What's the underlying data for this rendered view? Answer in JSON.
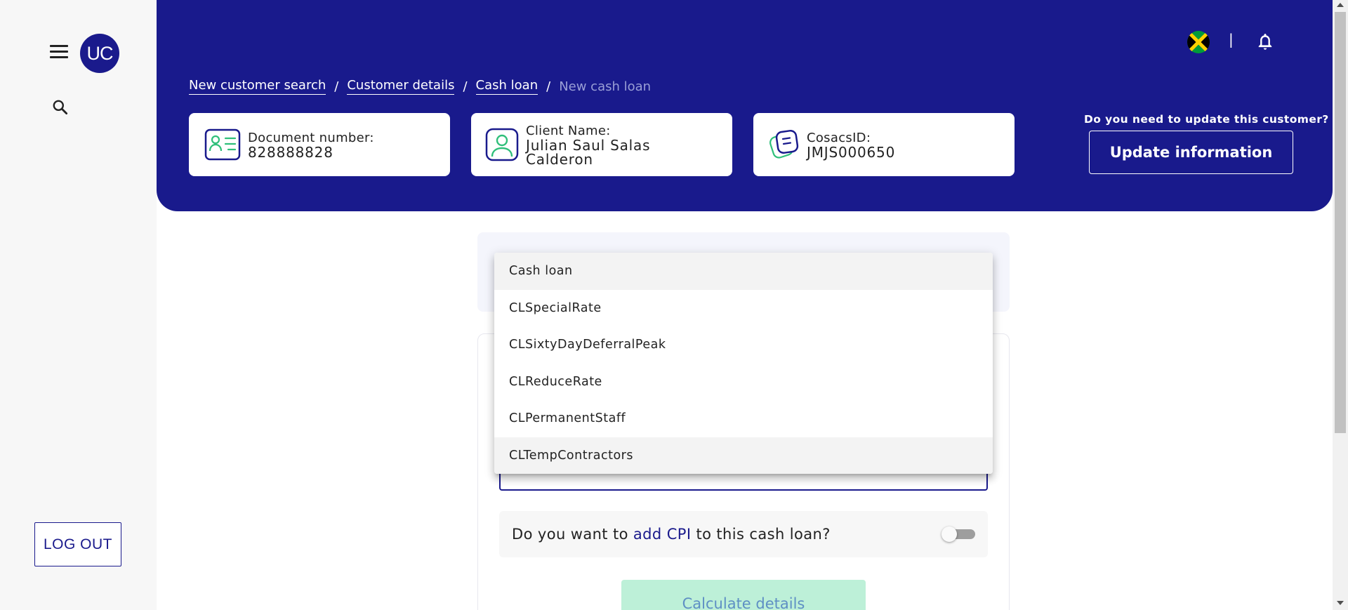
{
  "sidebar": {
    "avatar_text": "UC",
    "logout_label": "LOG OUT"
  },
  "header": {
    "separator": "|",
    "breadcrumb": [
      {
        "label": "New customer search"
      },
      {
        "label": "Customer details"
      },
      {
        "label": "Cash loan"
      },
      {
        "label": "New cash loan"
      }
    ],
    "breadcrumb_separator": "/",
    "cards": {
      "document": {
        "label": "Document number:",
        "value": "828888828"
      },
      "client": {
        "label": "Client Name:",
        "value": "Julian Saul Salas Calderon"
      },
      "cosacs": {
        "label": "CosacsID:",
        "value": "JMJS000650"
      }
    },
    "update_question": "Do you need to update this customer?",
    "update_button": "Update information"
  },
  "form": {
    "cpi": {
      "prefix": "Do you want to",
      "highlight": "add CPI",
      "suffix": "to this cash loan?",
      "enabled": false
    },
    "calculate_button": "Calculate details"
  },
  "dropdown": {
    "options": [
      "Cash loan",
      "CLSpecialRate",
      "CLSixtyDayDeferralPeak",
      "CLReduceRate",
      "CLPermanentStaff",
      "CLTempContractors"
    ]
  },
  "colors": {
    "primary": "#191a8c",
    "accent_green": "#2fbf7a",
    "calc_button_bg": "#bdf0d8"
  }
}
